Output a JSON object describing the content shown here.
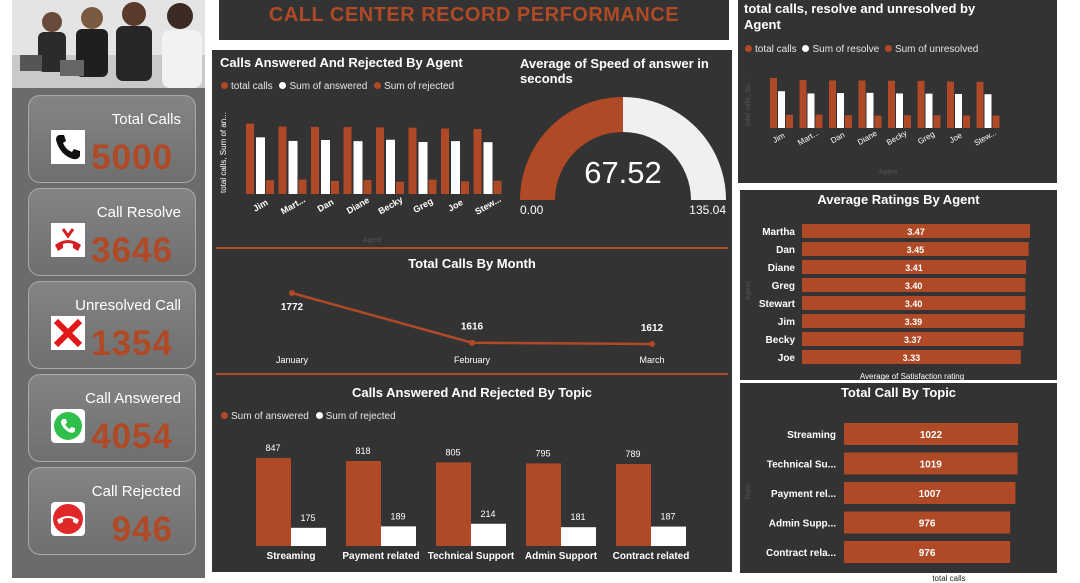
{
  "header": {
    "title": "CALL CENTER RECORD PERFORMANCE"
  },
  "colors": {
    "accent": "#b04a26",
    "panel": "#333333",
    "white": "#ffffff"
  },
  "kpis": [
    {
      "label": "Total Calls",
      "value": "5000",
      "icon": "phone-icon"
    },
    {
      "label": "Call Resolve",
      "value": "3646",
      "icon": "hangup-phone-icon"
    },
    {
      "label": "Unresolved Call",
      "value": "1354",
      "icon": "red-x-icon"
    },
    {
      "label": "Call Answered",
      "value": "4054",
      "icon": "whatsapp-phone-icon"
    },
    {
      "label": "Call Rejected",
      "value": "946",
      "icon": "reject-call-icon"
    }
  ],
  "agent_chart": {
    "title": "Calls Answered And Rejected By Agent",
    "legend": [
      "total calls",
      "Sum of answered",
      "Sum of rejected"
    ],
    "ylabel": "total calls, Sum of an...",
    "xlabel": "Agent"
  },
  "gauge": {
    "title": "Average of Speed of answer in seconds",
    "value": "67.52",
    "min": "0.00",
    "max": "135.04"
  },
  "month_chart": {
    "title": "Total Calls By Month"
  },
  "topic_chart": {
    "title": "Calls Answered And Rejected By Topic",
    "legend": [
      "Sum of answered",
      "Sum of rejected"
    ]
  },
  "resolve_chart": {
    "title": "total calls, resolve and unresolved by Agent",
    "legend": [
      "total calls",
      "Sum of resolve",
      "Sum of unresolved"
    ],
    "ylabel": "total calls, Su...",
    "xlabel": "Agent"
  },
  "ratings_chart": {
    "title": "Average Ratings By Agent",
    "xlabel": "Average of Satisfaction rating",
    "ylabel": "Agent"
  },
  "call_topic_chart": {
    "title": "Total Call By Topic",
    "xlabel": "total calls",
    "ylabel": "Topic"
  },
  "chart_data": [
    {
      "type": "bar",
      "title": "Calls Answered And Rejected By Agent",
      "categories": [
        "Jim",
        "Mart...",
        "Dan",
        "Diane",
        "Becky",
        "Greg",
        "Joe",
        "Stew..."
      ],
      "series": [
        {
          "name": "total calls",
          "values": [
            666,
            638,
            634,
            633,
            630,
            627,
            619,
            615
          ]
        },
        {
          "name": "Sum of answered",
          "values": [
            536,
            502,
            511,
            500,
            513,
            492,
            500,
            490
          ]
        },
        {
          "name": "Sum of rejected",
          "values": [
            130,
            136,
            123,
            133,
            117,
            135,
            119,
            125
          ]
        }
      ],
      "xlabel": "Agent",
      "ylabel": "total calls, Sum of an..."
    },
    {
      "type": "line",
      "title": "Total Calls By Month",
      "categories": [
        "January",
        "February",
        "March"
      ],
      "values": [
        1772,
        1616,
        1612
      ]
    },
    {
      "type": "bar",
      "title": "Calls Answered And Rejected By Topic",
      "categories": [
        "Streaming",
        "Payment related",
        "Technical Support",
        "Admin Support",
        "Contract related"
      ],
      "series": [
        {
          "name": "Sum of answered",
          "values": [
            847,
            818,
            805,
            795,
            789
          ]
        },
        {
          "name": "Sum of rejected",
          "values": [
            175,
            189,
            214,
            181,
            187
          ]
        }
      ]
    },
    {
      "type": "bar",
      "title": "total calls, resolve and unresolved by Agent",
      "categories": [
        "Jim",
        "Mart...",
        "Dan",
        "Diane",
        "Becky",
        "Greg",
        "Joe",
        "Stew..."
      ],
      "series": [
        {
          "name": "total calls",
          "values": [
            666,
            638,
            634,
            633,
            630,
            627,
            619,
            615
          ]
        },
        {
          "name": "Sum of resolve",
          "values": [
            490,
            460,
            465,
            468,
            460,
            458,
            453,
            450
          ]
        },
        {
          "name": "Sum of unresolved",
          "values": [
            176,
            178,
            169,
            165,
            170,
            169,
            166,
            165
          ]
        }
      ],
      "xlabel": "Agent",
      "ylabel": "total calls, Su..."
    },
    {
      "type": "bar",
      "orientation": "horizontal",
      "title": "Average Ratings By Agent",
      "categories": [
        "Martha",
        "Dan",
        "Diane",
        "Greg",
        "Stewart",
        "Jim",
        "Becky",
        "Joe"
      ],
      "values": [
        3.47,
        3.45,
        3.41,
        3.4,
        3.4,
        3.39,
        3.37,
        3.33
      ],
      "xlabel": "Average of Satisfaction rating",
      "ylabel": "Agent"
    },
    {
      "type": "bar",
      "orientation": "horizontal",
      "title": "Total Call By Topic",
      "categories": [
        "Streaming",
        "Technical Su...",
        "Payment rel...",
        "Admin Supp...",
        "Contract rela..."
      ],
      "values": [
        1022,
        1019,
        1007,
        976,
        976
      ],
      "xlabel": "total calls",
      "ylabel": "Topic"
    }
  ]
}
